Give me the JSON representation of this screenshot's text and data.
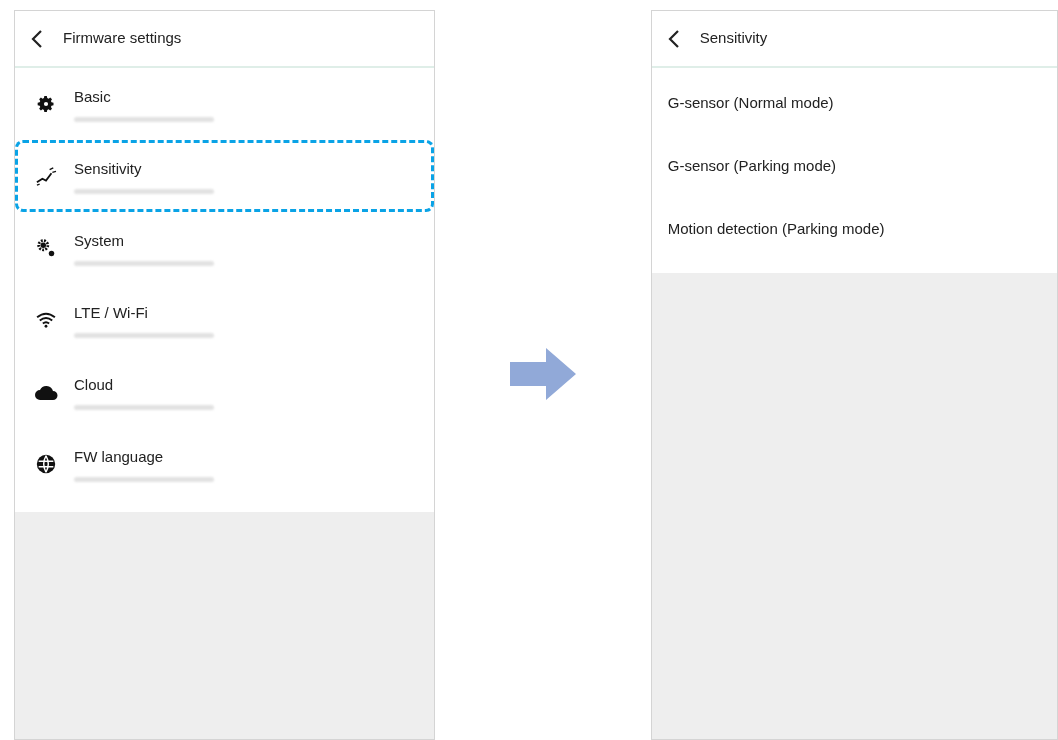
{
  "left_screen": {
    "title": "Firmware settings",
    "items": [
      {
        "label": "Basic",
        "kind": "gear",
        "highlighted": false
      },
      {
        "label": "Sensitivity",
        "kind": "sensor",
        "highlighted": true
      },
      {
        "label": "System",
        "kind": "gears",
        "highlighted": false
      },
      {
        "label": "LTE / Wi-Fi",
        "kind": "wifi",
        "highlighted": false
      },
      {
        "label": "Cloud",
        "kind": "cloud",
        "highlighted": false
      },
      {
        "label": "FW language",
        "kind": "globe",
        "highlighted": false
      }
    ]
  },
  "right_screen": {
    "title": "Sensitivity",
    "items": [
      {
        "label": "G-sensor (Normal mode)"
      },
      {
        "label": "G-sensor (Parking mode)"
      },
      {
        "label": "Motion detection (Parking mode)"
      }
    ]
  }
}
